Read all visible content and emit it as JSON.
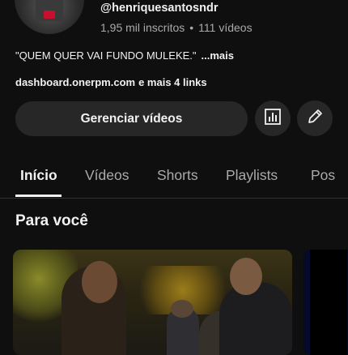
{
  "channel": {
    "handle": "@henriquesantosndr",
    "subscribers": "1,95 mil inscritos",
    "separator": "•",
    "videos_count": "111 vídeos",
    "bio": "\"QUEM QUER VAI FUNDO MULEKE.\"",
    "bio_more": "...mais",
    "link": "dashboard.onerpm.com",
    "more_links": "e mais 4 links"
  },
  "actions": {
    "manage_videos": "Gerenciar vídeos",
    "analytics_icon": "analytics-icon",
    "edit_icon": "pencil-icon"
  },
  "tabs": [
    {
      "label": "Início",
      "active": true
    },
    {
      "label": "Vídeos",
      "active": false
    },
    {
      "label": "Shorts",
      "active": false
    },
    {
      "label": "Playlists",
      "active": false
    },
    {
      "label": "Pos",
      "active": false
    }
  ],
  "section": {
    "title": "Para você"
  },
  "colors": {
    "background": "#0f0f0f",
    "button": "#272727",
    "text": "#f1f1f1",
    "secondary_text": "#aaaaaa"
  }
}
